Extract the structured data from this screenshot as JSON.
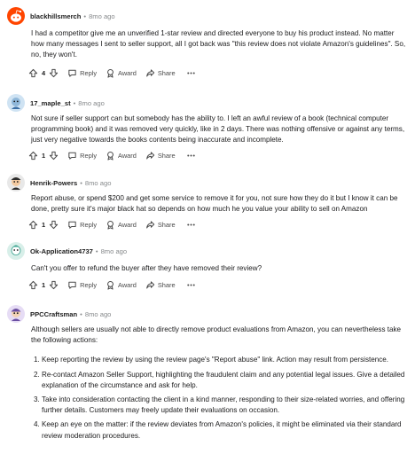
{
  "comments": [
    {
      "user": "blackhillsmerch",
      "age": "8mo ago",
      "avatar_icon": "reddit-snoo-avatar-red",
      "body": "I had a competitor give me an unverified 1-star review and directed everyone to buy his product instead. No matter how many messages I sent to seller support, all I got back was \"this review does not violate Amazon's guidelines\". So, no, they won't.",
      "votes": "4",
      "reply_label": "Reply",
      "award_label": "Award",
      "share_label": "Share"
    },
    {
      "user": "17_maple_st",
      "age": "8mo ago",
      "avatar_icon": "reddit-snoo-avatar-blue",
      "body": "Not sure if seller support can but somebody has the ability to. I left an awful review of a book (technical computer programming book) and it was removed very quickly, like in 2 days. There was nothing offensive or against any terms, just very negative towards the books contents being inaccurate and incomplete.",
      "votes": "1",
      "reply_label": "Reply",
      "award_label": "Award",
      "share_label": "Share"
    },
    {
      "user": "Henrik-Powers",
      "age": "8mo ago",
      "avatar_icon": "reddit-snoo-avatar-dark",
      "body": "Report abuse, or spend $200 and get some service to remove it for you, not sure how they do it but I know it can be done, pretty sure it's major black hat so depends on how much he you value your ability to sell on Amazon",
      "votes": "1",
      "reply_label": "Reply",
      "award_label": "Award",
      "share_label": "Share"
    },
    {
      "user": "Ok-Application4737",
      "age": "8mo ago",
      "avatar_icon": "reddit-snoo-avatar-teal",
      "body": "Can't you offer to refund the buyer after they have removed their review?",
      "votes": "1",
      "reply_label": "Reply",
      "award_label": "Award",
      "share_label": "Share"
    },
    {
      "user": "PPCCraftsman",
      "age": "8mo ago",
      "avatar_icon": "reddit-snoo-avatar-purple",
      "body": "Although sellers are usually not able to directly remove product evaluations from Amazon, you can nevertheless take the following actions:",
      "list": [
        "Keep reporting the review by using the review page's \"Report abuse\" link. Action may result from persistence.",
        "Re-contact Amazon Seller Support, highlighting the fraudulent claim and any potential legal issues. Give a detailed explanation of the circumstance and ask for help.",
        "Take into consideration contacting the client in a kind manner, responding to their size-related worries, and offering further details. Customers may freely update their evaluations on occasion.",
        "Keep an eye on the matter: if the review deviates from Amazon's policies, it might be eliminated via their standard review moderation procedures."
      ]
    }
  ],
  "separator": "•"
}
